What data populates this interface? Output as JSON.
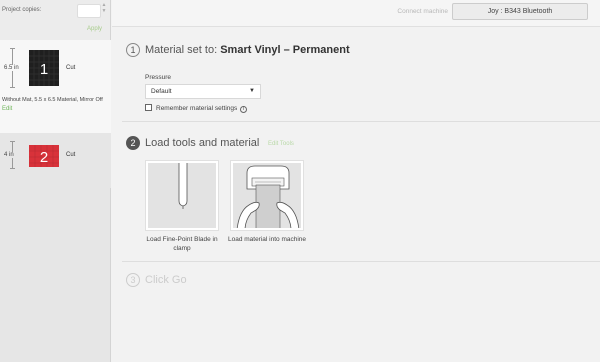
{
  "sidebar": {
    "copies_label": "Project copies:",
    "apply_label": "Apply",
    "mats": [
      {
        "dimension": "6.5 in",
        "number": "1",
        "cut_label": "Cut",
        "info": "Without Mat, 5.5 x 6.5 Material, Mirror Off",
        "edit_label": "Edit"
      },
      {
        "dimension": "4 in",
        "number": "2",
        "cut_label": "Cut"
      }
    ]
  },
  "topbar": {
    "connect_label": "Connect machine",
    "device_label": "Joy : B343 Bluetooth"
  },
  "step1": {
    "number": "1",
    "title_prefix": "Material set to: ",
    "material": "Smart Vinyl – Permanent",
    "pressure_label": "Pressure",
    "pressure_value": "Default",
    "remember_label": "Remember material settings",
    "info_glyph": "i"
  },
  "step2": {
    "number": "2",
    "title": "Load tools and material",
    "edit_tools_label": "Edit Tools",
    "cards": [
      {
        "caption": "Load Fine-Point Blade in clamp"
      },
      {
        "caption": "Load material into machine"
      }
    ]
  },
  "step3": {
    "number": "3",
    "title": "Click Go"
  },
  "colors": {
    "accent_green": "#6fb55b",
    "mat1": "#222222",
    "mat2": "#d8323a"
  },
  "icons": {
    "stepper": "chevron-up-down-icon",
    "dropdown": "caret-down-icon",
    "info": "info-icon"
  }
}
